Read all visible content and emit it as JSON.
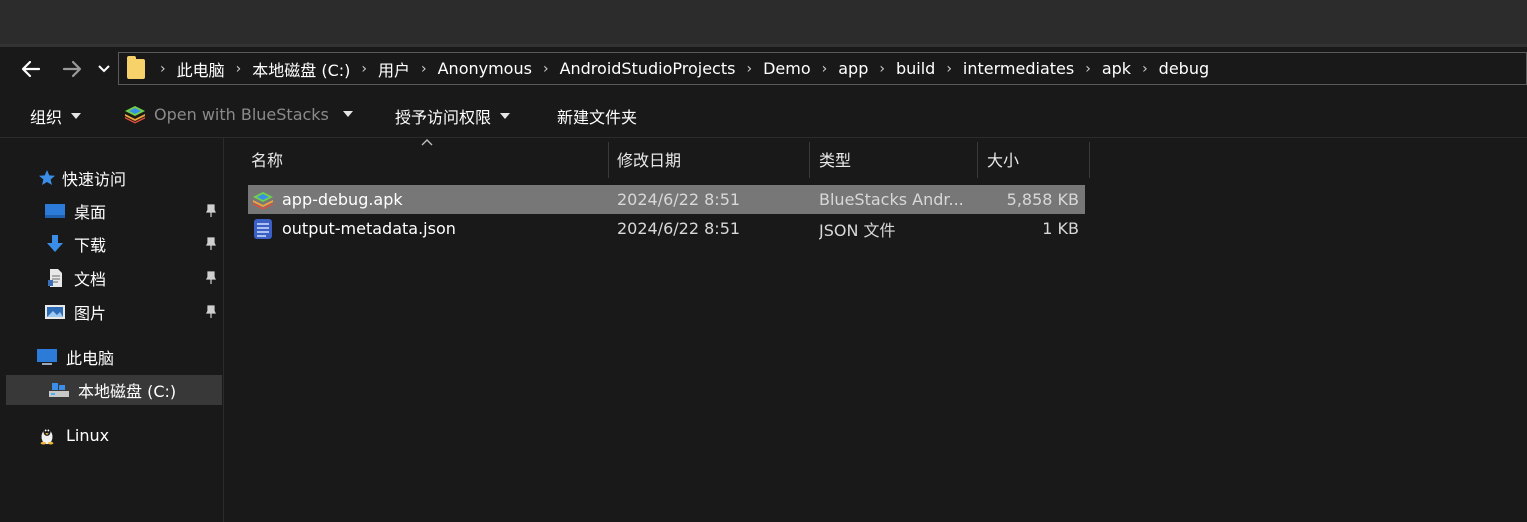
{
  "nav": {
    "back_label": "←",
    "forward_label": "→",
    "recent_label": "⌄"
  },
  "breadcrumb": [
    "此电脑",
    "本地磁盘 (C:)",
    "用户",
    "Anonymous",
    "AndroidStudioProjects",
    "Demo",
    "app",
    "build",
    "intermediates",
    "apk",
    "debug"
  ],
  "breadcrumb_separator": "›",
  "toolbar": {
    "organize": "组织",
    "open_with": "Open with BlueStacks",
    "grant_access": "授予访问权限",
    "new_folder": "新建文件夹"
  },
  "sidebar": {
    "quick_access": "快速访问",
    "quick_items": [
      {
        "label": "桌面",
        "icon": "desktop-icon"
      },
      {
        "label": "下载",
        "icon": "download-icon"
      },
      {
        "label": "文档",
        "icon": "document-icon"
      },
      {
        "label": "图片",
        "icon": "pictures-icon"
      }
    ],
    "this_pc": "此电脑",
    "local_disk": "本地磁盘 (C:)",
    "linux": "Linux"
  },
  "columns": {
    "name": "名称",
    "modified": "修改日期",
    "type": "类型",
    "size": "大小"
  },
  "files": [
    {
      "name": "app-debug.apk",
      "modified": "2024/6/22 8:51",
      "type": "BlueStacks Andr...",
      "size": "5,858 KB",
      "icon": "bluestacks-icon",
      "selected": true
    },
    {
      "name": "output-metadata.json",
      "modified": "2024/6/22 8:51",
      "type": "JSON 文件",
      "size": "1 KB",
      "icon": "json-file-icon",
      "selected": false
    }
  ],
  "colors": {
    "background": "#191919",
    "titlebar": "#2c2c2c",
    "selection": "#777777",
    "folder": "#f7d26a",
    "accent_blue": "#3b8ee8"
  }
}
